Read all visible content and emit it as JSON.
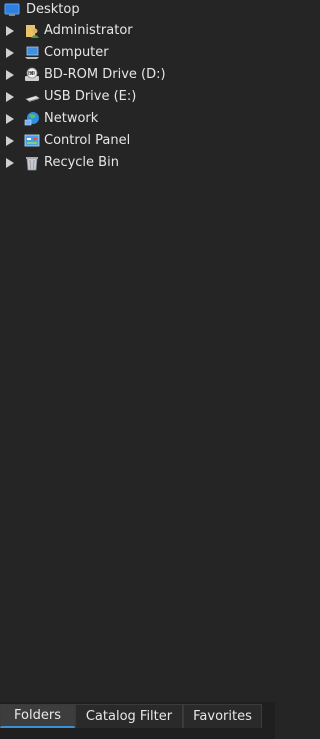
{
  "tree": {
    "root": {
      "label": "Desktop",
      "icon": "desktop-icon"
    },
    "items": [
      {
        "label": "Administrator",
        "icon": "user-folder-icon"
      },
      {
        "label": "Computer",
        "icon": "computer-icon"
      },
      {
        "label": "BD-ROM Drive (D:)",
        "icon": "optical-drive-icon"
      },
      {
        "label": "USB Drive (E:)",
        "icon": "usb-drive-icon"
      },
      {
        "label": "Network",
        "icon": "network-icon"
      },
      {
        "label": "Control Panel",
        "icon": "control-panel-icon"
      },
      {
        "label": "Recycle Bin",
        "icon": "recycle-bin-icon"
      }
    ]
  },
  "tabs": [
    {
      "label": "Folders",
      "active": true
    },
    {
      "label": "Catalog Filter",
      "active": false
    },
    {
      "label": "Favorites",
      "active": false
    }
  ],
  "colors": {
    "background": "#252525",
    "text": "#e6e6e6",
    "active_tab_accent": "#3a8fd6"
  }
}
